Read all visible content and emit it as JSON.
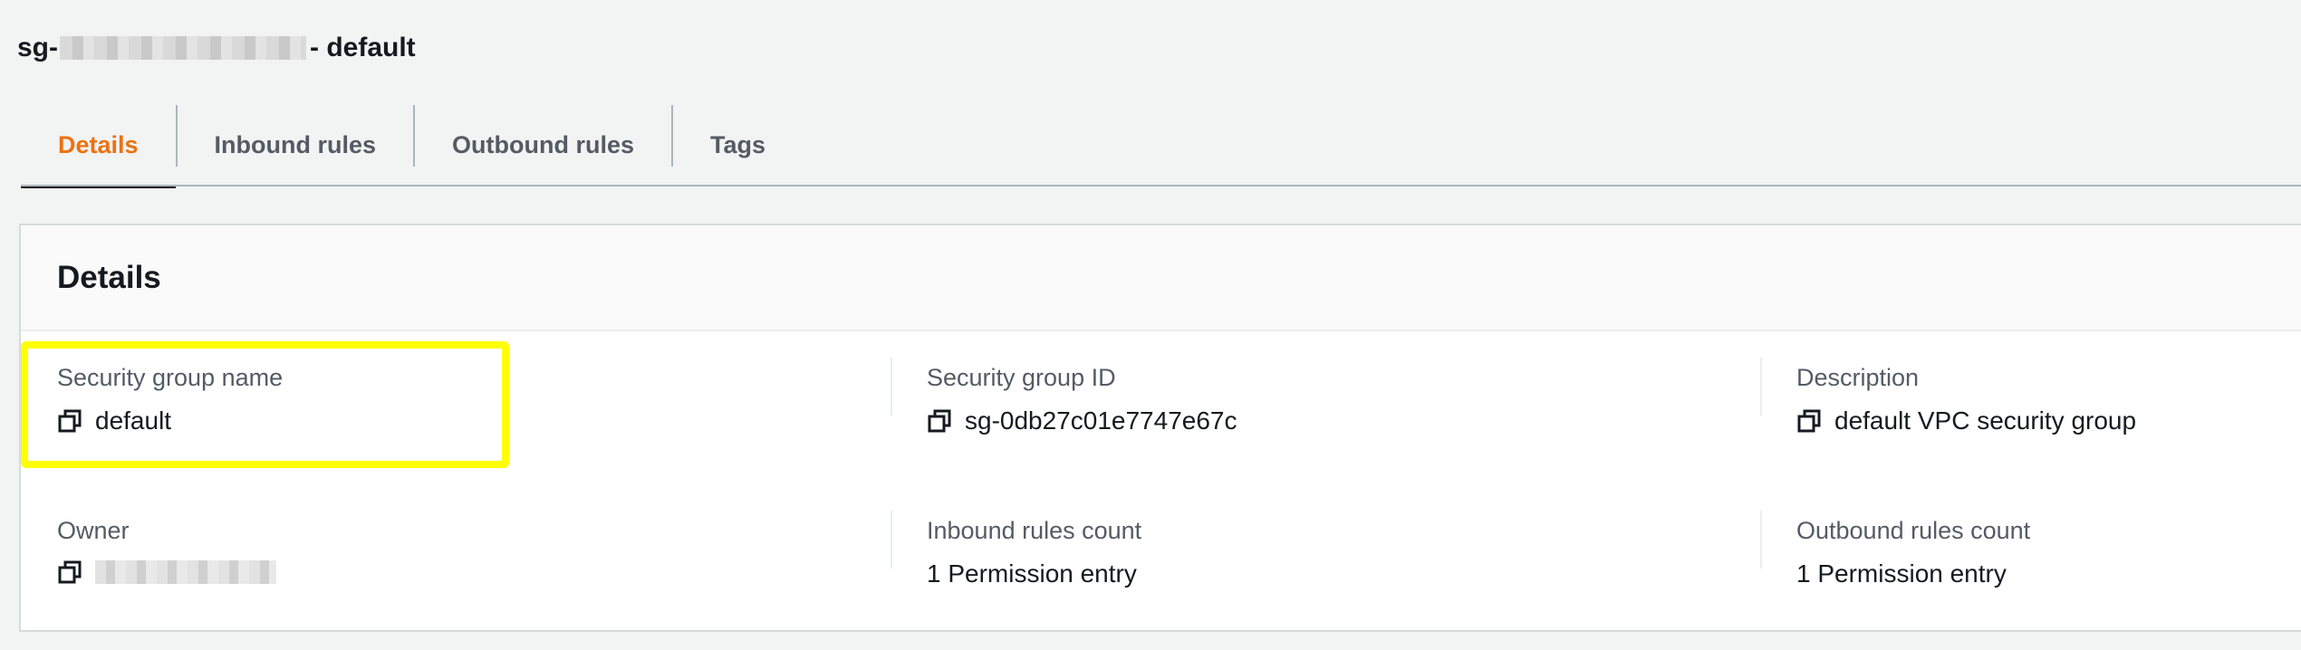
{
  "header": {
    "title_prefix": "sg-",
    "title_suffix": "- default",
    "title_redacted": true
  },
  "tabs": [
    {
      "label": "Details",
      "active": true
    },
    {
      "label": "Inbound rules",
      "active": false
    },
    {
      "label": "Outbound rules",
      "active": false
    },
    {
      "label": "Tags",
      "active": false
    }
  ],
  "panel": {
    "title": "Details",
    "fields": {
      "security_group_name": {
        "label": "Security group name",
        "value": "default",
        "copy_icon": "copy-icon"
      },
      "security_group_id": {
        "label": "Security group ID",
        "value": "sg-0db27c01e7747e67c",
        "copy_icon": "copy-icon"
      },
      "description": {
        "label": "Description",
        "value": "default VPC security group",
        "copy_icon": "copy-icon"
      },
      "owner": {
        "label": "Owner",
        "value_redacted": true,
        "copy_icon": "copy-icon"
      },
      "inbound_rules_count": {
        "label": "Inbound rules count",
        "value": "1 Permission entry"
      },
      "outbound_rules_count": {
        "label": "Outbound rules count",
        "value": "1 Permission entry"
      }
    }
  },
  "colors": {
    "active_tab": "#ec7211",
    "highlight": "#ffff00",
    "background": "#f2f3f3"
  }
}
